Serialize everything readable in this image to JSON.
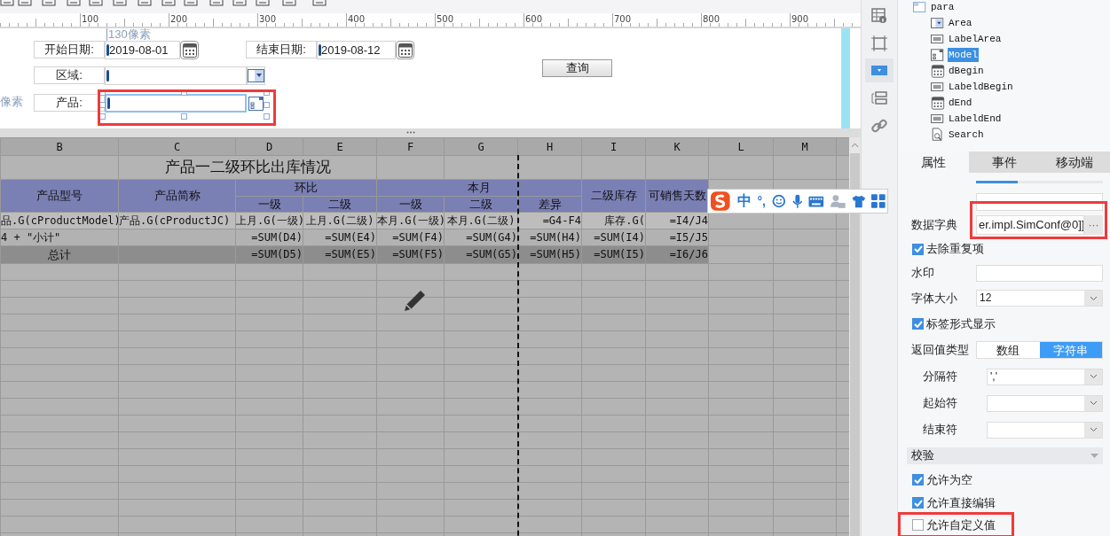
{
  "ruler": {
    "labels": [
      "100",
      "200",
      "300",
      "400",
      "500",
      "600",
      "700",
      "800",
      "900"
    ]
  },
  "canvas": {
    "width_hint": "130像素",
    "height_hint": "像素",
    "widgets": [
      {
        "kind": "label",
        "text": "开始日期:"
      },
      {
        "kind": "date",
        "value": "2019-08-01",
        "selected": false
      },
      {
        "kind": "label",
        "text": "结束日期:"
      },
      {
        "kind": "date",
        "value": "2019-08-12",
        "selected": false
      },
      {
        "kind": "label",
        "text": "区域:"
      },
      {
        "kind": "combo",
        "selected": false
      },
      {
        "kind": "label",
        "text": "产品:"
      },
      {
        "kind": "tree",
        "selected": true,
        "highlighted": true
      },
      {
        "kind": "button",
        "text": "查询"
      }
    ]
  },
  "sheet": {
    "columns": [
      "B",
      "C",
      "D",
      "E",
      "F",
      "G",
      "H",
      "I",
      "K",
      "L",
      "M"
    ],
    "title": "产品一二级环比出库情况",
    "header_top": [
      "产品型号",
      "产品简称",
      "环比",
      "本月",
      "二级库存",
      "可销售天数"
    ],
    "header_sub": [
      "一级",
      "二级",
      "一级",
      "二级",
      "差异"
    ],
    "rows": [
      {
        "kind": "detail",
        "cells": [
          "品.G(cProductModel)",
          "产品.G(cProductJC)",
          "上月.G(一级)",
          "上月.G(二级)",
          "本月.G(一级)",
          "本月.G(二级)",
          "=G4-F4",
          "库存.G(",
          "=I4/J4"
        ]
      },
      {
        "kind": "subtotal",
        "cells": [
          "4 + \"小计\"",
          "=SUM(D4)",
          "=SUM(E4)",
          "=SUM(F4)",
          "=SUM(G4)",
          "=SUM(H4)",
          "=SUM(I4)",
          "=I5/J5"
        ]
      },
      {
        "kind": "total",
        "cells": [
          "总计",
          "=SUM(D5)",
          "=SUM(E5)",
          "=SUM(F5)",
          "=SUM(G5)",
          "=SUM(H5)",
          "=SUM(I5)",
          "=I6/J6"
        ]
      }
    ]
  },
  "ime_bar": {
    "mode": "中",
    "punctuation": "°,"
  },
  "side_tools": [
    {
      "selected": false
    },
    {
      "selected": false
    },
    {
      "selected": true
    },
    {
      "selected": false
    },
    {
      "selected": false
    }
  ],
  "tree": {
    "items": [
      {
        "label": "para",
        "kind": "folder",
        "selected": false,
        "children": [
          {
            "label": "Area",
            "kind": "combo",
            "selected": false
          },
          {
            "label": "LabelArea",
            "kind": "label",
            "selected": false
          },
          {
            "label": "Model",
            "kind": "tree",
            "selected": true
          },
          {
            "label": "dBegin",
            "kind": "date",
            "selected": false
          },
          {
            "label": "LabeldBegin",
            "kind": "label",
            "selected": false
          },
          {
            "label": "dEnd",
            "kind": "date",
            "selected": false
          },
          {
            "label": "LabeldEnd",
            "kind": "label",
            "selected": false
          },
          {
            "label": "Search",
            "kind": "search",
            "selected": false
          }
        ]
      }
    ]
  },
  "tabs": [
    {
      "label": "属性",
      "selected": true
    },
    {
      "label": "事件",
      "selected": false
    },
    {
      "label": "移动端",
      "selected": false
    }
  ],
  "properties": [
    {
      "kind": "bar",
      "level": 0.33
    },
    {
      "kind": "blank"
    },
    {
      "kind": "button_field",
      "label": "数据字典",
      "value": "er.impl.SimConf@0]]",
      "button": "···",
      "highlighted": true
    },
    {
      "kind": "checkbox",
      "label": "去除重复项",
      "checked": true
    },
    {
      "kind": "text",
      "label": "水印"
    },
    {
      "kind": "select",
      "label": "字体大小",
      "value": "12"
    },
    {
      "kind": "checkbox",
      "label": "标签形式显示",
      "checked": true
    },
    {
      "kind": "segmented",
      "label": "返回值类型",
      "options": [
        {
          "label": "数组",
          "selected": false
        },
        {
          "label": "字符串",
          "selected": true
        }
      ]
    },
    {
      "kind": "sub_select",
      "label": "分隔符",
      "value": "','"
    },
    {
      "kind": "sub_select",
      "label": "起始符"
    },
    {
      "kind": "sub_select",
      "label": "结束符"
    },
    {
      "kind": "section",
      "label": "校验"
    },
    {
      "kind": "checkbox",
      "label": "允许为空",
      "checked": true
    },
    {
      "kind": "checkbox",
      "label": "允许直接编辑",
      "checked": true
    },
    {
      "kind": "checkbox",
      "label": "允许自定义值",
      "checked": false,
      "highlighted": true
    }
  ]
}
